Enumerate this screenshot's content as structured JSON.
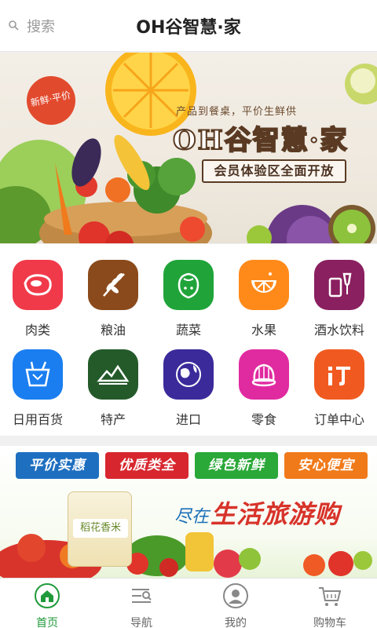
{
  "header": {
    "search_label": "搜索",
    "title": "OH谷智慧·家"
  },
  "banner": {
    "fresh_badge": "新鲜·平价",
    "tagline": "产品到餐桌，平价生鲜供",
    "brand": "OH谷智慧·家",
    "subtitle": "会员体验区全面开放"
  },
  "categories": [
    {
      "label": "肉类",
      "icon": "meat-icon",
      "color": "#f03a4a"
    },
    {
      "label": "粮油",
      "icon": "grain-icon",
      "color": "#8a4a1c"
    },
    {
      "label": "蔬菜",
      "icon": "vegetable-icon",
      "color": "#20a43a"
    },
    {
      "label": "水果",
      "icon": "orange-slice-icon",
      "color": "#ff8a1a"
    },
    {
      "label": "酒水饮料",
      "icon": "drink-icon",
      "color": "#8a2060"
    },
    {
      "label": "日用百货",
      "icon": "shopping-bag-icon",
      "color": "#1a7ef0"
    },
    {
      "label": "特产",
      "icon": "mountain-icon",
      "color": "#245a2a"
    },
    {
      "label": "进口",
      "icon": "globe-icon",
      "color": "#3a2a9a"
    },
    {
      "label": "零食",
      "icon": "jelly-icon",
      "color": "#e02aa0"
    },
    {
      "label": "订单中心",
      "icon": "order-icon",
      "color": "#f05a20"
    }
  ],
  "promo": {
    "chips": [
      {
        "label": "平价实惠",
        "color": "#1e6fc0"
      },
      {
        "label": "优质类全",
        "color": "#d8262e"
      },
      {
        "label": "绿色新鲜",
        "color": "#2aa838"
      },
      {
        "label": "安心便宜",
        "color": "#f07a1a"
      }
    ],
    "slogan_a": "尽在",
    "slogan_b": "生活旅游购",
    "rice_label": "稻花香米"
  },
  "tabs": [
    {
      "label": "首页",
      "icon": "home-icon",
      "active": true
    },
    {
      "label": "导航",
      "icon": "navigation-list-icon",
      "active": false
    },
    {
      "label": "我的",
      "icon": "user-icon",
      "active": false
    },
    {
      "label": "购物车",
      "icon": "cart-icon",
      "active": false
    }
  ],
  "colors": {
    "accent": "#1f9a3a"
  }
}
